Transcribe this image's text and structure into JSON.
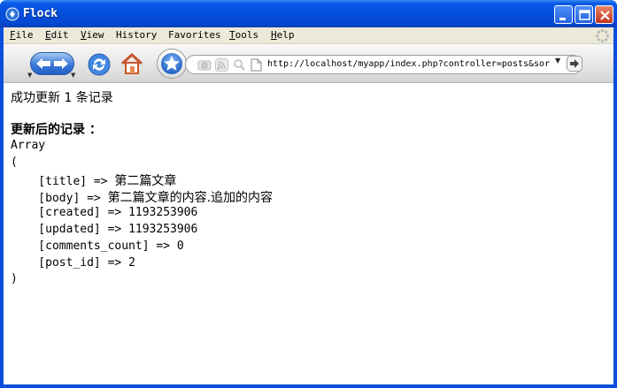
{
  "window": {
    "title": "Flock"
  },
  "menubar": {
    "items": [
      {
        "first": "F",
        "rest": "ile"
      },
      {
        "first": "E",
        "rest": "dit"
      },
      {
        "first": "V",
        "rest": "iew"
      },
      {
        "first": "",
        "rest": "History"
      },
      {
        "first": "",
        "rest": "Favorites"
      },
      {
        "first": "T",
        "rest": "ools"
      },
      {
        "first": "H",
        "rest": "elp"
      }
    ]
  },
  "toolbar": {
    "url": "http://localhost/myapp/index.php?controller=posts&sor",
    "icons": [
      "back-icon",
      "forward-icon",
      "reload-icon",
      "home-icon",
      "favorites-star-icon",
      "photo-icon",
      "rss-icon",
      "search-icon",
      "page-icon",
      "go-arrow-icon"
    ]
  },
  "content": {
    "message": "成功更新 1 条记录",
    "heading": "更新后的记录 ：",
    "array_label": "Array",
    "open_paren": "(",
    "close_paren": ")",
    "rows": [
      {
        "key": "    [title] => ",
        "value": "第二篇文章"
      },
      {
        "key": "    [body] => ",
        "value": "第二篇文章的内容.追加的内容"
      },
      {
        "key": "    [created] => ",
        "value": "1193253906"
      },
      {
        "key": "    [updated] => ",
        "value": "1193253906"
      },
      {
        "key": "    [comments_count] => ",
        "value": "0"
      },
      {
        "key": "    [post_id] => ",
        "value": "2"
      }
    ]
  },
  "colors": {
    "titlebar": "#0550df",
    "menubar": "#ece9d8",
    "close_button": "#c2351a"
  }
}
